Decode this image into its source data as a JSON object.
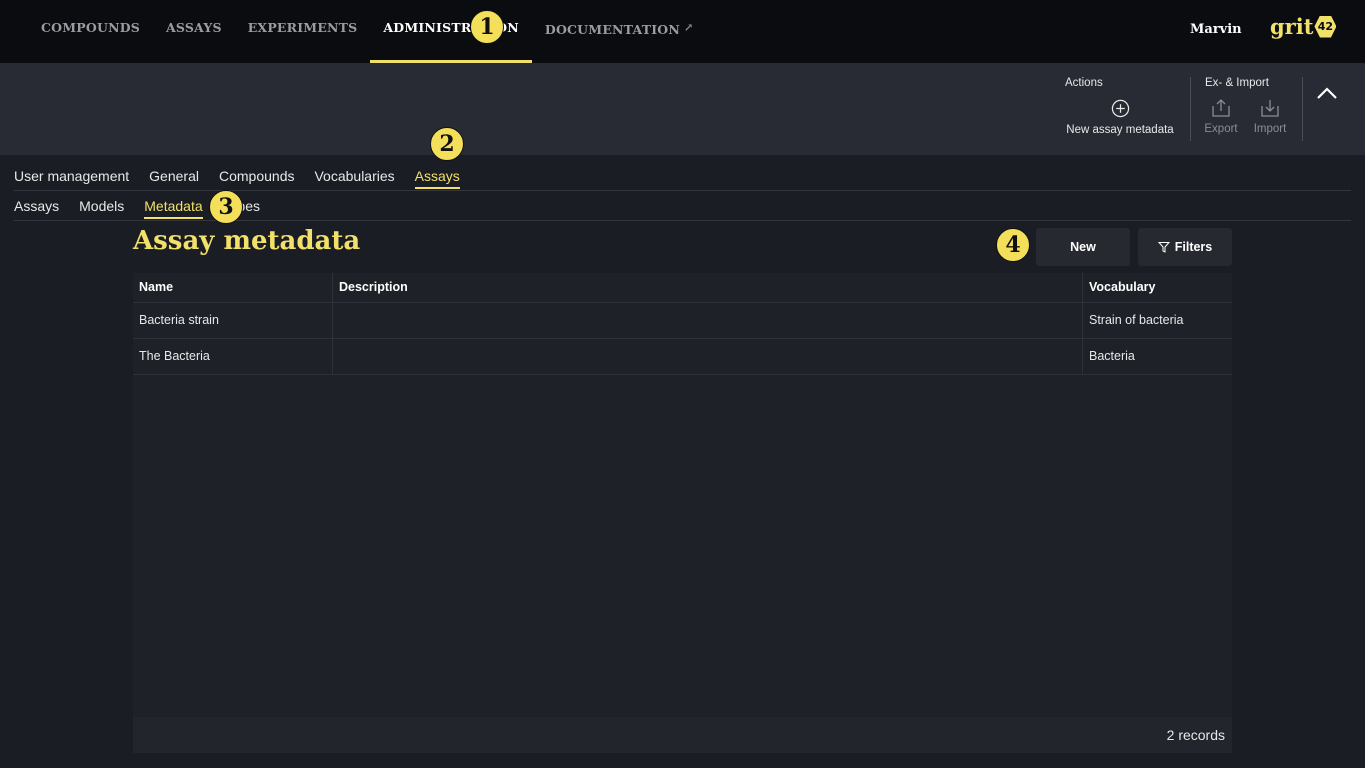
{
  "topnav": {
    "items": [
      {
        "label": "COMPOUNDS"
      },
      {
        "label": "ASSAYS"
      },
      {
        "label": "EXPERIMENTS"
      },
      {
        "label": "ADMINISTRATION"
      },
      {
        "label": "DOCUMENTATION"
      }
    ],
    "active": "ADMINISTRATION",
    "user": "Marvin",
    "logo_text": "grit",
    "logo_badge": "42"
  },
  "toolbar": {
    "actions_title": "Actions",
    "new_label": "New assay metadata",
    "eximport_title": "Ex- & Import",
    "export_label": "Export",
    "import_label": "Import"
  },
  "tabs_primary": [
    "User management",
    "General",
    "Compounds",
    "Vocabularies",
    "Assays"
  ],
  "tabs_primary_active": "Assays",
  "tabs_secondary": [
    "Assays",
    "Models",
    "Metadata",
    "Types"
  ],
  "tabs_secondary_active": "Metadata",
  "badges": [
    "1",
    "2",
    "3",
    "4"
  ],
  "page": {
    "title": "Assay metadata",
    "new_button": "New",
    "filters_button": "Filters"
  },
  "table": {
    "columns": [
      "Name",
      "Description",
      "Vocabulary"
    ],
    "rows": [
      {
        "name": "Bacteria strain",
        "description": "",
        "vocabulary": "Strain of bacteria"
      },
      {
        "name": "The Bacteria",
        "description": "",
        "vocabulary": "Bacteria"
      }
    ],
    "records": "2 records"
  },
  "colors": {
    "accent": "#f1e06a",
    "background": "#1a1d23",
    "topbar": "#0b0c10"
  }
}
